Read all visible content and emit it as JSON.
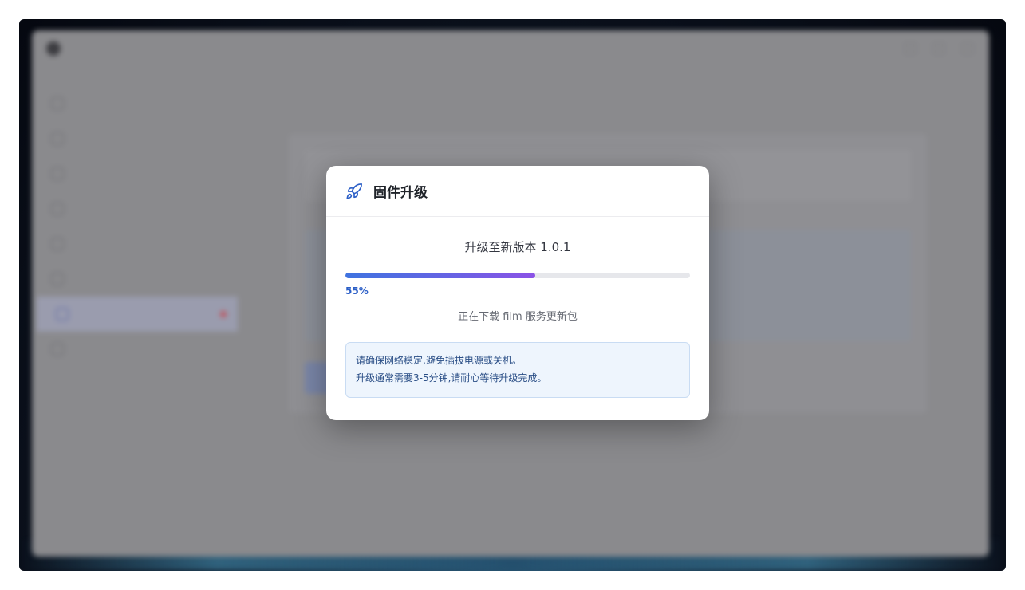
{
  "background_app": {
    "sidebar": {
      "item_count": 8,
      "active_index": 6
    }
  },
  "modal": {
    "title": "固件升级",
    "icon": "rocket-icon",
    "version_text": "升级至新版本 1.0.1",
    "progress": {
      "percent": 55,
      "label": "55%"
    },
    "status": "正在下载 film 服务更新包",
    "notice_lines": [
      "请确保网络稳定,避免插拔电源或关机。",
      "升级通常需要3-5分钟,请耐心等待升级完成。"
    ]
  },
  "colors": {
    "accent": "#2c5fc7",
    "progress_start": "#3f73e0",
    "progress_end": "#8b52e6",
    "notice_bg": "#eef5fd",
    "notice_border": "#c9dcf3"
  }
}
